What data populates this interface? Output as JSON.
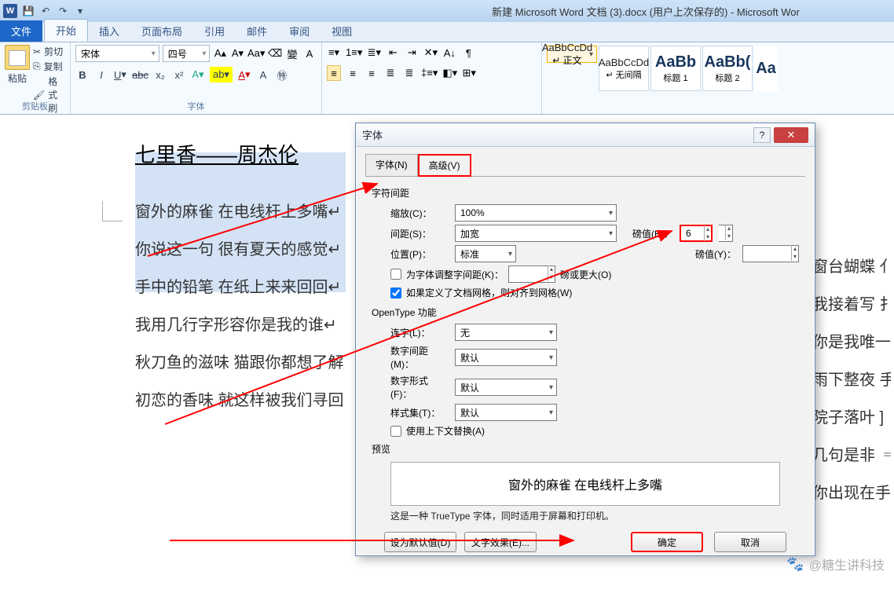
{
  "titlebar": {
    "doc_title": "新建 Microsoft Word 文档 (3).docx (用户上次保存的) - Microsoft Wor"
  },
  "tabs": {
    "file": "文件",
    "home": "开始",
    "insert": "插入",
    "layout": "页面布局",
    "ref": "引用",
    "mail": "邮件",
    "review": "审阅",
    "view": "视图"
  },
  "ribbon": {
    "clipboard": {
      "paste": "粘贴",
      "cut": "剪切",
      "copy": "复制",
      "fmt": "格式刷",
      "label": "剪贴板"
    },
    "font": {
      "name": "宋体",
      "size": "四号",
      "label": "字体"
    },
    "styles": {
      "s1": {
        "preview": "AaBbCcDd",
        "name": "↵ 正文"
      },
      "s2": {
        "preview": "AaBbCcDd",
        "name": "↵ 无间隔"
      },
      "s3": {
        "preview": "AaBb",
        "name": "标题 1"
      },
      "s4": {
        "preview": "AaBb(",
        "name": "标题 2"
      },
      "s5": {
        "preview": "Aa",
        "name": ""
      }
    }
  },
  "doc": {
    "title": "七里香——周杰伦",
    "l1": "窗外的麻雀 在电线杆上多嘴↵",
    "l2": "你说这一句 很有夏天的感觉↵",
    "l3": "手中的铅笔 在纸上来来回回↵",
    "l4": "我用几行字形容你是我的谁↵",
    "l5": "秋刀鱼的滋味 猫跟你都想了解",
    "l6": "初恋的香味 就这样被我们寻回",
    "r1": "窗台蝴蝶 亻",
    "r2": "我接着写 扌",
    "r3": "你是我唯一",
    "r4": "雨下整夜 手",
    "r5": "院子落叶 ]",
    "r6": "几句是非 ゠",
    "r7": "你出现在手"
  },
  "dialog": {
    "title": "字体",
    "tab_font": "字体(N)",
    "tab_adv": "高级(V)",
    "section_spacing": "字符间距",
    "scale_label": "缩放(C)：",
    "scale_value": "100%",
    "spacing_label": "间距(S)：",
    "spacing_value": "加宽",
    "by_label": "磅值(B)：",
    "by_value": "6",
    "pos_label": "位置(P)：",
    "pos_value": "标准",
    "pos_by_label": "磅值(Y)：",
    "kern_label": "为字体调整字间距(K)：",
    "kern_unit": "磅或更大(O)",
    "snap_label": "如果定义了文档网格，则对齐到网格(W)",
    "section_ot": "OpenType 功能",
    "lig_label": "连字(L)：",
    "lig_value": "无",
    "numspc_label": "数字间距(M)：",
    "numspc_value": "默认",
    "numform_label": "数字形式(F)：",
    "numform_value": "默认",
    "styset_label": "样式集(T)：",
    "styset_value": "默认",
    "ctx_label": "使用上下文替换(A)",
    "preview_label": "预览",
    "preview_text": "窗外的麻雀 在电线杆上多嘴",
    "preview_note": "这是一种 TrueType 字体，同时适用于屏幕和打印机。",
    "btn_default": "设为默认值(D)",
    "btn_effects": "文字效果(E)...",
    "btn_ok": "确定",
    "btn_cancel": "取消"
  },
  "watermark": "@糖生讲科技"
}
